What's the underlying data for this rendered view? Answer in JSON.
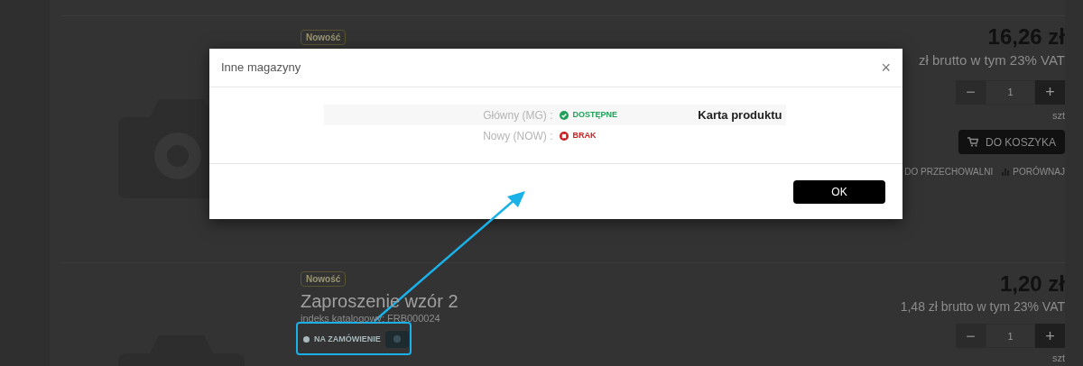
{
  "products": [
    {
      "badge": "Nowość",
      "price": "16,26 zł",
      "gross": "zł brutto w tym 23% VAT",
      "minus_button": "−",
      "quantity": "1",
      "plus_button": "+",
      "unit": "szt",
      "cart_button": "DO KOSZYKA",
      "links": [
        "DO PRZECHOWALNI",
        "PORÓWNAJ"
      ]
    },
    {
      "badge": "Nowość",
      "title": "Zaproszenie wzór 2",
      "index": "indeks katalogowy: FRB000024",
      "availability": "NA ZAMÓWIENIE",
      "price": "1,20 zł",
      "gross": "1,48 zł brutto w tym 23% VAT",
      "minus_button": "−",
      "quantity": "1",
      "plus_button": "+",
      "unit": "szt"
    }
  ],
  "dialog": {
    "title": "Inne magazyny",
    "close_button": "×",
    "rows": [
      {
        "warehouse": "Główny (MG) :",
        "status": "DOSTĘPNE",
        "available": true,
        "link": "Karta produktu"
      },
      {
        "warehouse": "Nowy (NOW) :",
        "status": "BRAK",
        "available": false
      }
    ],
    "ok_button": "OK"
  }
}
